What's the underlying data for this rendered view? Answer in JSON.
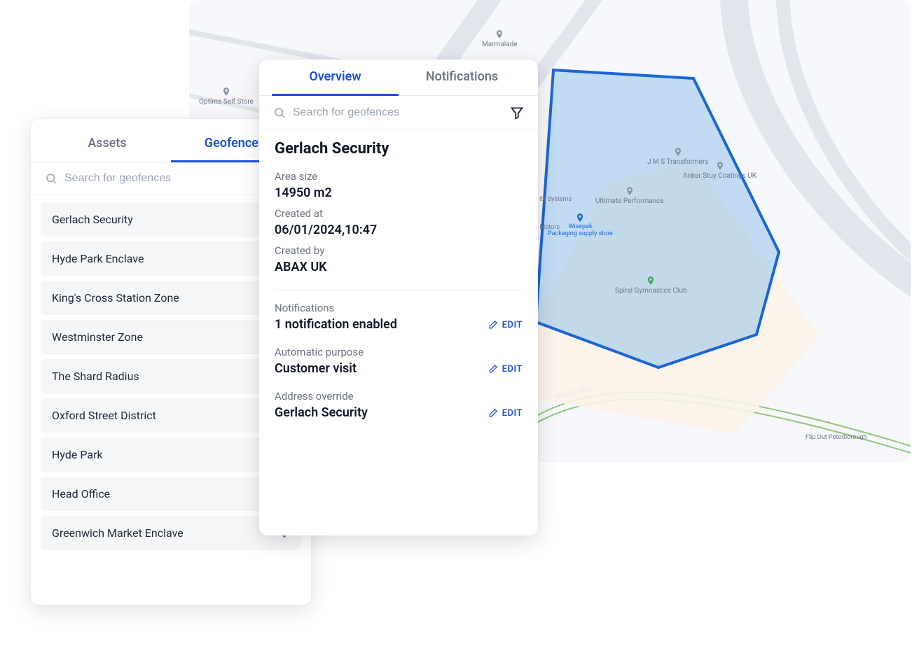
{
  "left_panel": {
    "tabs": {
      "assets": "Assets",
      "geofences": "Geofences"
    },
    "search_placeholder": "Search for geofences",
    "items": [
      "Gerlach Security",
      "Hyde Park Enclave",
      "King's Cross Station Zone",
      "Westminster Zone",
      "The Shard Radius",
      "Oxford Street District",
      "Hyde Park",
      "Head Office",
      "Greenwich Market Enclave"
    ]
  },
  "detail_panel": {
    "tabs": {
      "overview": "Overview",
      "notifications": "Notifications"
    },
    "search_placeholder": "Search for geofences",
    "title": "Gerlach Security",
    "area_label": "Area size",
    "area_value": "14950 m2",
    "created_at_label": "Created at",
    "created_at_value": "06/01/2024,10:47",
    "created_by_label": "Created by",
    "created_by_value": "ABAX UK",
    "notifications_label": "Notifications",
    "notifications_value": "1 notification enabled",
    "purpose_label": "Automatic purpose",
    "purpose_value": "Customer visit",
    "address_label": "Address override",
    "address_value": "Gerlach Security",
    "edit_label": "EDIT"
  },
  "map": {
    "poi": {
      "marmalade": "Marmalade",
      "optima": "Optima Self Store",
      "jms": "J M S Transformers",
      "anker": "Anker Stuy Coatings UK",
      "ultimate": "Ultimate Performance",
      "wisepak_name": "Wisepak",
      "wisepak_sub": "Packaging supply store",
      "systems": "ity Systems",
      "motors": "Park Motors",
      "spiral": "Spiral Gymnastics Club",
      "flip": "Flip Out Peterborough",
      "bretton": "Bretton Way"
    }
  }
}
